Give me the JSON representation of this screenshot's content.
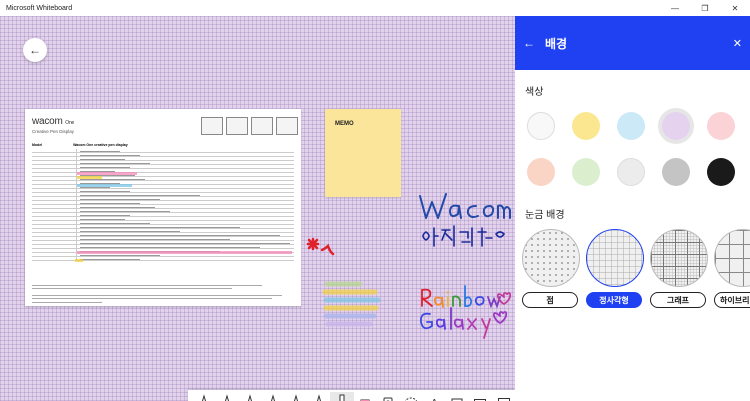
{
  "app": {
    "title": "Microsoft Whiteboard"
  },
  "window_controls": {
    "minimize": "—",
    "restore": "❐",
    "close": "✕"
  },
  "canvas": {
    "background": "#e2d2ec",
    "back_icon": "arrow-left-icon",
    "document": {
      "brand": "wacom",
      "brand_suffix": "One",
      "subtitle": "Creative Pen Display",
      "table_header": [
        "Model",
        "Wacom One creative pen display"
      ]
    },
    "memo": {
      "label": "MEMO",
      "color": "#fae59b"
    },
    "handwriting": [
      "Wacom",
      "Rainbow",
      "Galaxy"
    ]
  },
  "toolbar": {
    "tools": [
      {
        "name": "pen-black",
        "color": "#111111"
      },
      {
        "name": "pen-red",
        "color": "#e23a3a"
      },
      {
        "name": "pen-green",
        "color": "#2a9a3a"
      },
      {
        "name": "pen-blue",
        "color": "#2a4ae2"
      },
      {
        "name": "pen-pink",
        "color": "#d43a9a"
      },
      {
        "name": "pen-purple",
        "color": "#6a2ac2"
      },
      {
        "name": "highlighter",
        "color": "#f2d23a"
      },
      {
        "name": "eraser",
        "color": "#f28ab2"
      }
    ],
    "icons": [
      "lasso-icon",
      "text-icon",
      "note-icon",
      "image-icon",
      "add-icon"
    ],
    "text_tool_label": "A"
  },
  "panel": {
    "title": "배경",
    "back_icon": "arrow-left-icon",
    "close_icon": "close-icon",
    "accent": "#1f41f2",
    "color_label": "색상",
    "colors": [
      "#f8f8f8",
      "#fbe790",
      "#cbe9f6",
      "#e5d2ef",
      "#fbd3d6",
      "#fad4c4",
      "#dbefcf",
      "#ececec",
      "#c4c4c4",
      "#1a1a1a"
    ],
    "selected_color": 3,
    "grid_label": "눈금 배경",
    "grid_options": [
      "점",
      "정사각형",
      "그래프",
      "하이브리"
    ],
    "selected_grid": 1
  }
}
